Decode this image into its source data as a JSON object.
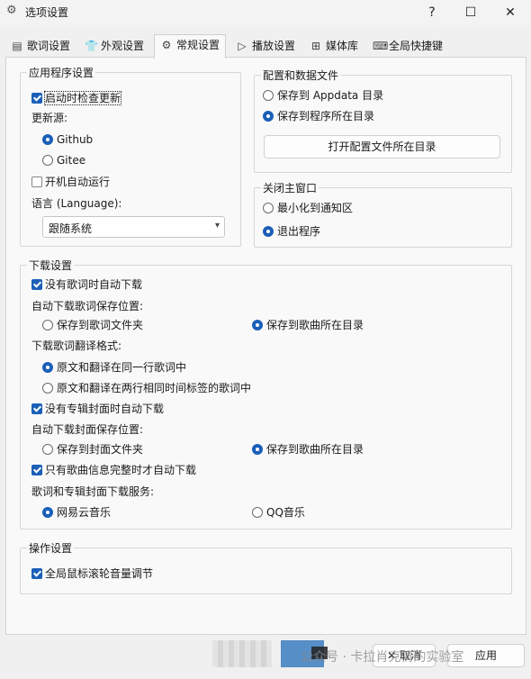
{
  "window": {
    "title": "选项设置",
    "icon": "gear-icon",
    "controls": {
      "help": "?",
      "maximize": "☐",
      "close": "✕"
    }
  },
  "tabs": [
    {
      "label": "歌词设置",
      "icon": "lyrics-icon"
    },
    {
      "label": "外观设置",
      "icon": "shirt-icon"
    },
    {
      "label": "常规设置",
      "icon": "gear-icon",
      "active": true
    },
    {
      "label": "播放设置",
      "icon": "play-icon"
    },
    {
      "label": "媒体库",
      "icon": "grid-icon"
    },
    {
      "label": "全局快捷键",
      "icon": "keyboard-icon"
    }
  ],
  "app_settings": {
    "title": "应用程序设置",
    "auto_check_update": {
      "label": "启动时检查更新",
      "checked": true
    },
    "update_source_label": "更新源:",
    "sources": [
      {
        "label": "Github",
        "checked": true
      },
      {
        "label": "Gitee",
        "checked": false
      }
    ],
    "autorun": {
      "label": "开机自动运行",
      "checked": false
    },
    "language_label": "语言 (Language):",
    "language_value": "跟随系统"
  },
  "config_files": {
    "title": "配置和数据文件",
    "options": [
      {
        "label": "保存到 Appdata 目录",
        "checked": false
      },
      {
        "label": "保存到程序所在目录",
        "checked": true
      }
    ],
    "open_dir_button": "打开配置文件所在目录"
  },
  "close_window": {
    "title": "关闭主窗口",
    "options": [
      {
        "label": "最小化到通知区",
        "checked": false
      },
      {
        "label": "退出程序",
        "checked": true
      }
    ]
  },
  "download": {
    "title": "下载设置",
    "auto_download_lyrics": {
      "label": "没有歌词时自动下载",
      "checked": true
    },
    "lyrics_save_label": "自动下载歌词保存位置:",
    "lyrics_save_options": [
      {
        "label": "保存到歌词文件夹",
        "checked": false
      },
      {
        "label": "保存到歌曲所在目录",
        "checked": true
      }
    ],
    "translation_format_label": "下载歌词翻译格式:",
    "translation_options": [
      {
        "label": "原文和翻译在同一行歌词中",
        "checked": true
      },
      {
        "label": "原文和翻译在两行相同时间标签的歌词中",
        "checked": false
      }
    ],
    "auto_download_cover": {
      "label": "没有专辑封面时自动下载",
      "checked": true
    },
    "cover_save_label": "自动下载封面保存位置:",
    "cover_save_options": [
      {
        "label": "保存到封面文件夹",
        "checked": false
      },
      {
        "label": "保存到歌曲所在目录",
        "checked": true
      }
    ],
    "only_complete_info": {
      "label": "只有歌曲信息完整时才自动下载",
      "checked": true
    },
    "service_label": "歌词和专辑封面下载服务:",
    "service_options": [
      {
        "label": "网易云音乐",
        "checked": true
      },
      {
        "label": "QQ音乐",
        "checked": false
      }
    ]
  },
  "operation": {
    "title": "操作设置",
    "wheel_volume": {
      "label": "全局鼠标滚轮音量调节",
      "checked": true
    }
  },
  "footer": {
    "cancel_label": "取消",
    "apply_label": "应用"
  },
  "watermark": "公众号 · 卡拉肖克倩的实验室",
  "colors": {
    "accent": "#1b5fb8"
  }
}
